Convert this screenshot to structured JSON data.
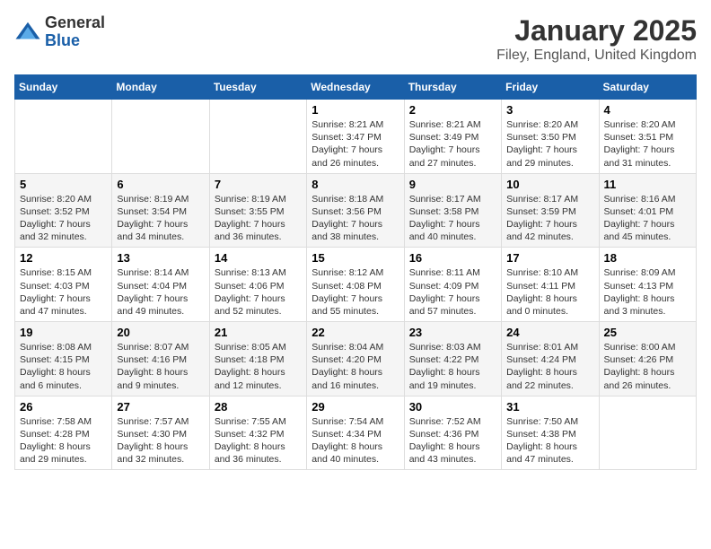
{
  "logo": {
    "general": "General",
    "blue": "Blue"
  },
  "title": "January 2025",
  "subtitle": "Filey, England, United Kingdom",
  "days_of_week": [
    "Sunday",
    "Monday",
    "Tuesday",
    "Wednesday",
    "Thursday",
    "Friday",
    "Saturday"
  ],
  "weeks": [
    [
      {
        "day": "",
        "content": ""
      },
      {
        "day": "",
        "content": ""
      },
      {
        "day": "",
        "content": ""
      },
      {
        "day": "1",
        "content": "Sunrise: 8:21 AM\nSunset: 3:47 PM\nDaylight: 7 hours\nand 26 minutes."
      },
      {
        "day": "2",
        "content": "Sunrise: 8:21 AM\nSunset: 3:49 PM\nDaylight: 7 hours\nand 27 minutes."
      },
      {
        "day": "3",
        "content": "Sunrise: 8:20 AM\nSunset: 3:50 PM\nDaylight: 7 hours\nand 29 minutes."
      },
      {
        "day": "4",
        "content": "Sunrise: 8:20 AM\nSunset: 3:51 PM\nDaylight: 7 hours\nand 31 minutes."
      }
    ],
    [
      {
        "day": "5",
        "content": "Sunrise: 8:20 AM\nSunset: 3:52 PM\nDaylight: 7 hours\nand 32 minutes."
      },
      {
        "day": "6",
        "content": "Sunrise: 8:19 AM\nSunset: 3:54 PM\nDaylight: 7 hours\nand 34 minutes."
      },
      {
        "day": "7",
        "content": "Sunrise: 8:19 AM\nSunset: 3:55 PM\nDaylight: 7 hours\nand 36 minutes."
      },
      {
        "day": "8",
        "content": "Sunrise: 8:18 AM\nSunset: 3:56 PM\nDaylight: 7 hours\nand 38 minutes."
      },
      {
        "day": "9",
        "content": "Sunrise: 8:17 AM\nSunset: 3:58 PM\nDaylight: 7 hours\nand 40 minutes."
      },
      {
        "day": "10",
        "content": "Sunrise: 8:17 AM\nSunset: 3:59 PM\nDaylight: 7 hours\nand 42 minutes."
      },
      {
        "day": "11",
        "content": "Sunrise: 8:16 AM\nSunset: 4:01 PM\nDaylight: 7 hours\nand 45 minutes."
      }
    ],
    [
      {
        "day": "12",
        "content": "Sunrise: 8:15 AM\nSunset: 4:03 PM\nDaylight: 7 hours\nand 47 minutes."
      },
      {
        "day": "13",
        "content": "Sunrise: 8:14 AM\nSunset: 4:04 PM\nDaylight: 7 hours\nand 49 minutes."
      },
      {
        "day": "14",
        "content": "Sunrise: 8:13 AM\nSunset: 4:06 PM\nDaylight: 7 hours\nand 52 minutes."
      },
      {
        "day": "15",
        "content": "Sunrise: 8:12 AM\nSunset: 4:08 PM\nDaylight: 7 hours\nand 55 minutes."
      },
      {
        "day": "16",
        "content": "Sunrise: 8:11 AM\nSunset: 4:09 PM\nDaylight: 7 hours\nand 57 minutes."
      },
      {
        "day": "17",
        "content": "Sunrise: 8:10 AM\nSunset: 4:11 PM\nDaylight: 8 hours\nand 0 minutes."
      },
      {
        "day": "18",
        "content": "Sunrise: 8:09 AM\nSunset: 4:13 PM\nDaylight: 8 hours\nand 3 minutes."
      }
    ],
    [
      {
        "day": "19",
        "content": "Sunrise: 8:08 AM\nSunset: 4:15 PM\nDaylight: 8 hours\nand 6 minutes."
      },
      {
        "day": "20",
        "content": "Sunrise: 8:07 AM\nSunset: 4:16 PM\nDaylight: 8 hours\nand 9 minutes."
      },
      {
        "day": "21",
        "content": "Sunrise: 8:05 AM\nSunset: 4:18 PM\nDaylight: 8 hours\nand 12 minutes."
      },
      {
        "day": "22",
        "content": "Sunrise: 8:04 AM\nSunset: 4:20 PM\nDaylight: 8 hours\nand 16 minutes."
      },
      {
        "day": "23",
        "content": "Sunrise: 8:03 AM\nSunset: 4:22 PM\nDaylight: 8 hours\nand 19 minutes."
      },
      {
        "day": "24",
        "content": "Sunrise: 8:01 AM\nSunset: 4:24 PM\nDaylight: 8 hours\nand 22 minutes."
      },
      {
        "day": "25",
        "content": "Sunrise: 8:00 AM\nSunset: 4:26 PM\nDaylight: 8 hours\nand 26 minutes."
      }
    ],
    [
      {
        "day": "26",
        "content": "Sunrise: 7:58 AM\nSunset: 4:28 PM\nDaylight: 8 hours\nand 29 minutes."
      },
      {
        "day": "27",
        "content": "Sunrise: 7:57 AM\nSunset: 4:30 PM\nDaylight: 8 hours\nand 32 minutes."
      },
      {
        "day": "28",
        "content": "Sunrise: 7:55 AM\nSunset: 4:32 PM\nDaylight: 8 hours\nand 36 minutes."
      },
      {
        "day": "29",
        "content": "Sunrise: 7:54 AM\nSunset: 4:34 PM\nDaylight: 8 hours\nand 40 minutes."
      },
      {
        "day": "30",
        "content": "Sunrise: 7:52 AM\nSunset: 4:36 PM\nDaylight: 8 hours\nand 43 minutes."
      },
      {
        "day": "31",
        "content": "Sunrise: 7:50 AM\nSunset: 4:38 PM\nDaylight: 8 hours\nand 47 minutes."
      },
      {
        "day": "",
        "content": ""
      }
    ]
  ]
}
